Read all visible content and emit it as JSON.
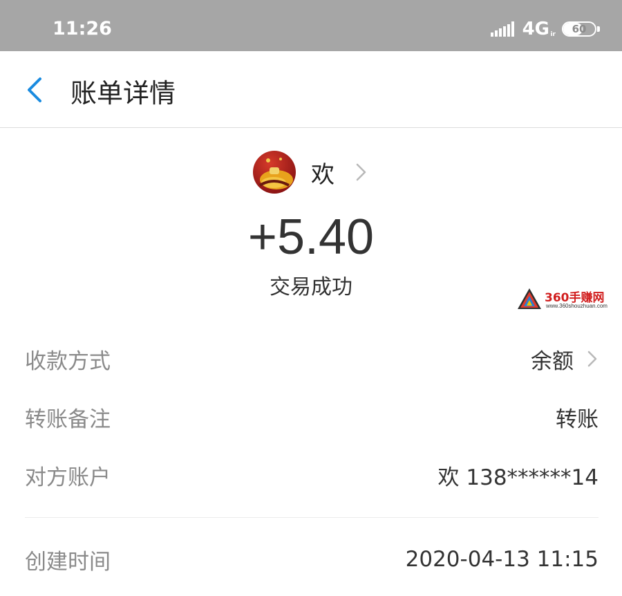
{
  "status_bar": {
    "time": "11:26",
    "network": "4G",
    "network_sub": "ir",
    "battery_percent": 60,
    "battery_label": "60"
  },
  "header": {
    "title": "账单详情",
    "back_icon": "chevron-left-icon",
    "accent_color": "#1a8be0"
  },
  "payee": {
    "name": "欢",
    "avatar_icon": "avatar-image",
    "chevron_icon": "chevron-right-icon"
  },
  "transaction": {
    "amount": "+5.40",
    "status": "交易成功"
  },
  "watermark": {
    "name": "360手赚网",
    "url": "www.360shouzhuan.com"
  },
  "details": {
    "payment_method": {
      "label": "收款方式",
      "value": "余额"
    },
    "remark": {
      "label": "转账备注",
      "value": "转账"
    },
    "counterparty": {
      "label": "对方账户",
      "value": "欢 138******14"
    },
    "created_time": {
      "label": "创建时间",
      "value": "2020-04-13 11:15"
    }
  }
}
